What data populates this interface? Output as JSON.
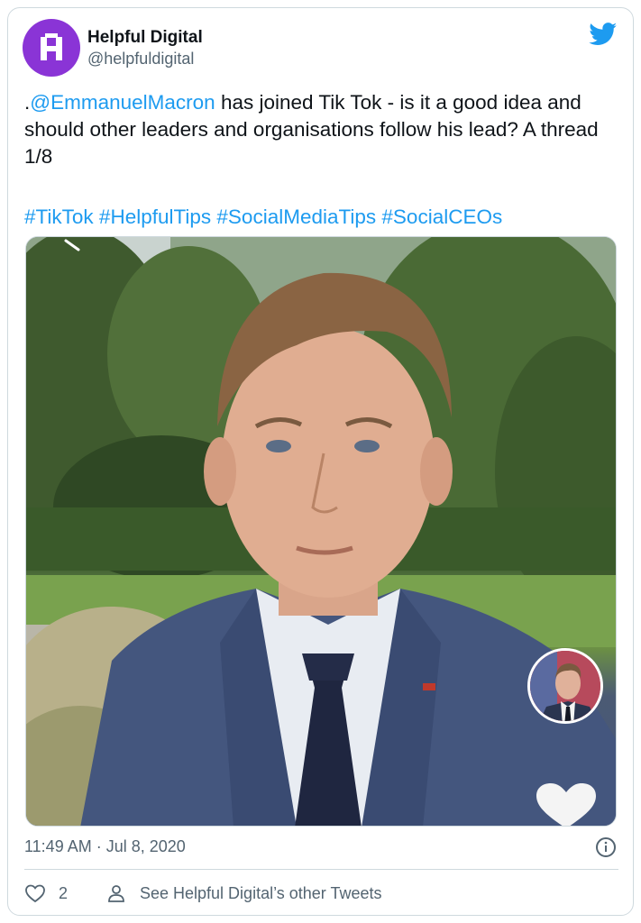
{
  "account": {
    "name": "Helpful Digital",
    "handle": "@helpfuldigital",
    "avatar_letter": "H",
    "avatar_color": "#8a34d6"
  },
  "tweet": {
    "text_prefix": ".",
    "mention": "@EmmanuelMacron",
    "text_body": " has joined Tik Tok - is it a good idea and should other leaders and organisations follow his lead? A thread 1/8",
    "hashtags": "#TikTok #HelpfulTips #SocialMediaTips #SocialCEOs",
    "link_color": "#1d9bf0"
  },
  "media": {
    "icons": [
      "close-icon",
      "profile-thumbnail",
      "heart-icon"
    ]
  },
  "meta": {
    "timestamp": "11:49 AM · Jul 8, 2020"
  },
  "actions": {
    "like_count": "2",
    "others_label": "See Helpful Digital’s other Tweets"
  },
  "brand": {
    "twitter_blue": "#1d9bf0"
  }
}
